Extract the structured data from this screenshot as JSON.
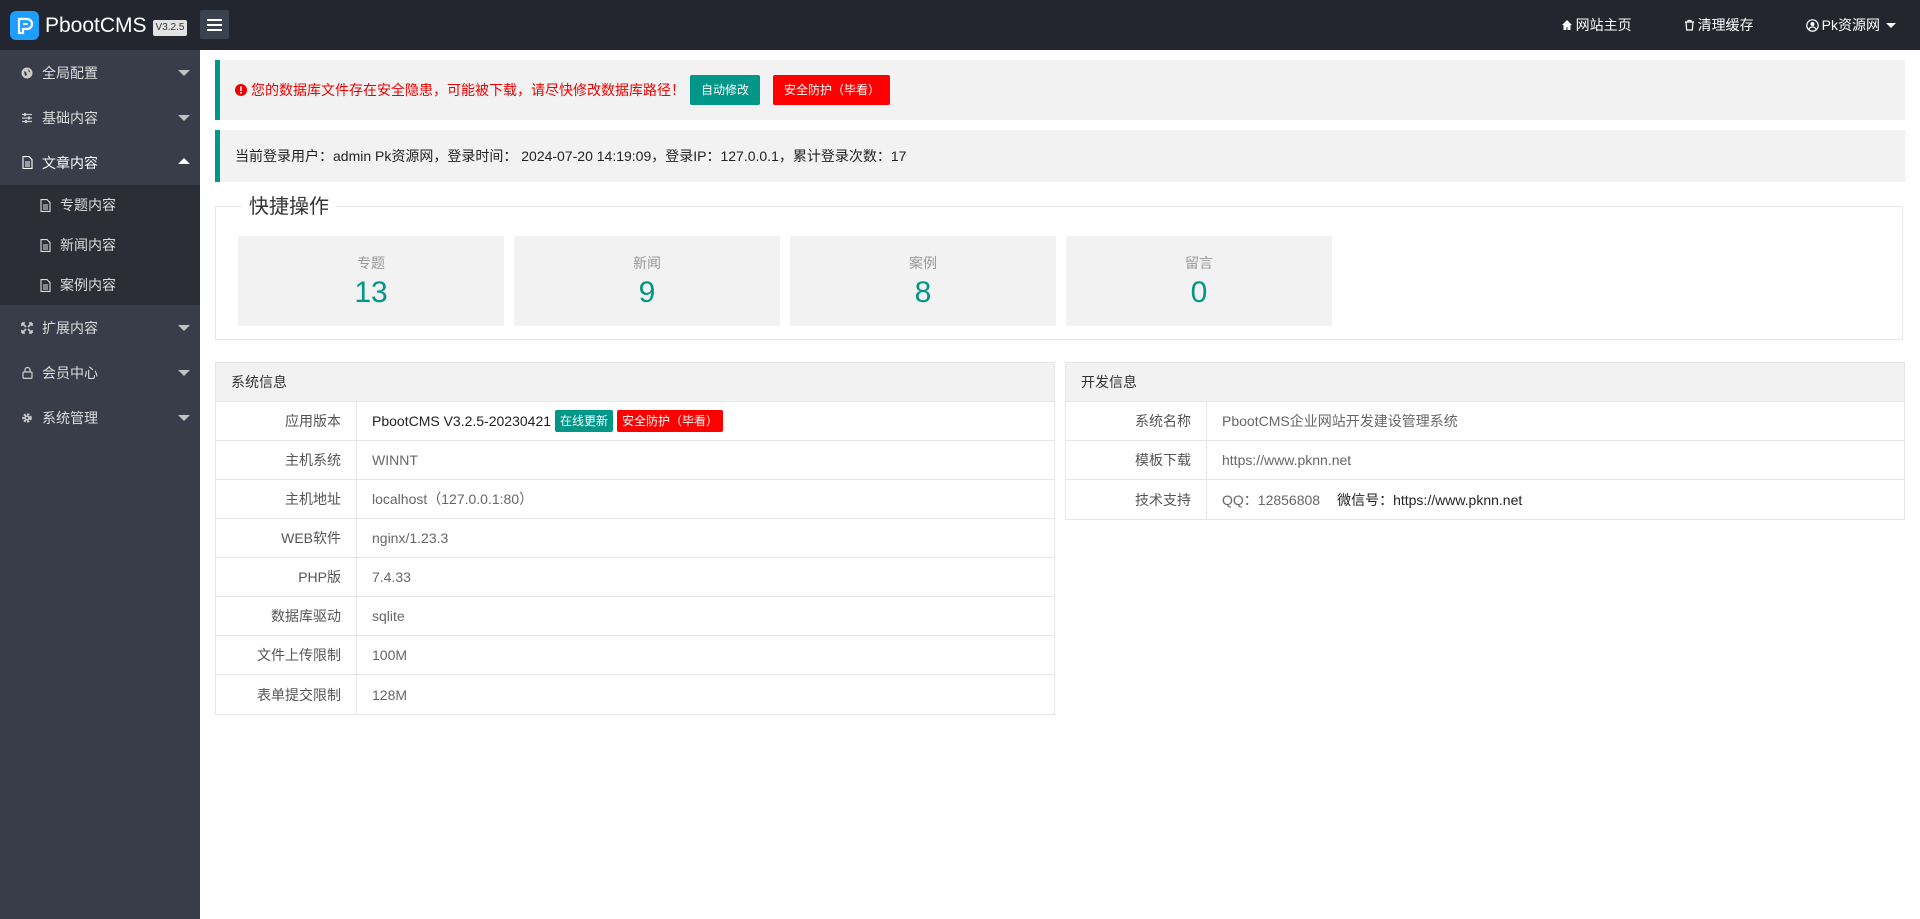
{
  "header": {
    "app_name": "PbootCMS",
    "version": "V3.2.5",
    "links": {
      "home": "网站主页",
      "clear_cache": "清理缓存",
      "user": "Pk资源网"
    }
  },
  "sidebar": {
    "items": [
      {
        "label": "全局配置",
        "icon": "globe-icon"
      },
      {
        "label": "基础内容",
        "icon": "sliders-icon"
      },
      {
        "label": "文章内容",
        "icon": "file-icon"
      },
      {
        "label": "扩展内容",
        "icon": "expand-icon"
      },
      {
        "label": "会员中心",
        "icon": "lock-icon"
      },
      {
        "label": "系统管理",
        "icon": "gear-icon"
      }
    ],
    "sub_items": [
      "专题内容",
      "新闻内容",
      "案例内容"
    ]
  },
  "alert": {
    "warning": "您的数据库文件存在安全隐患，可能被下载，请尽快修改数据库路径！",
    "auto_fix": "自动修改",
    "security": "安全防护（毕看）"
  },
  "login_info": "当前登录用户：admin Pk资源网，登录时间： 2024-07-20 14:19:09，登录IP：127.0.0.1，累计登录次数：17",
  "quick": {
    "title": "快捷操作",
    "cards": [
      {
        "label": "专题",
        "value": "13"
      },
      {
        "label": "新闻",
        "value": "9"
      },
      {
        "label": "案例",
        "value": "8"
      },
      {
        "label": "留言",
        "value": "0"
      }
    ]
  },
  "system_info": {
    "title": "系统信息",
    "rows": [
      {
        "label": "应用版本",
        "value": "PbootCMS V3.2.5-20230421"
      },
      {
        "label": "主机系统",
        "value": "WINNT"
      },
      {
        "label": "主机地址",
        "value": "localhost（127.0.0.1:80）"
      },
      {
        "label": "WEB软件",
        "value": "nginx/1.23.3"
      },
      {
        "label": "PHP版",
        "value": "7.4.33"
      },
      {
        "label": "数据库驱动",
        "value": "sqlite"
      },
      {
        "label": "文件上传限制",
        "value": "100M"
      },
      {
        "label": "表单提交限制",
        "value": "128M"
      }
    ],
    "online_update": "在线更新",
    "security": "安全防护（毕看）"
  },
  "dev_info": {
    "title": "开发信息",
    "rows": [
      {
        "label": "系统名称",
        "value": "PbootCMS企业网站开发建设管理系统"
      },
      {
        "label": "模板下载",
        "value": "https://www.pknn.net"
      },
      {
        "label": "技术支持",
        "value": "QQ：12856808"
      }
    ],
    "wechat_label": "微信号：",
    "wechat_value": "https://www.pknn.net"
  },
  "colors": {
    "accent": "#009688",
    "danger": "#ff0000",
    "header_bg": "#23262e",
    "sidebar_bg": "#393d49"
  }
}
